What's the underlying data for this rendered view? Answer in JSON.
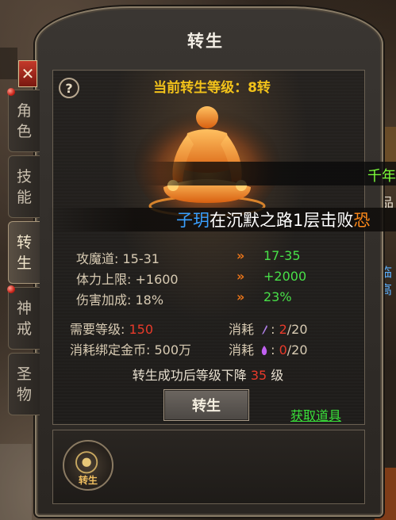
{
  "window": {
    "title": "转生",
    "close_label": "✕",
    "help_label": "?"
  },
  "tabs": [
    {
      "label": "角色",
      "chars": [
        "角",
        "色"
      ],
      "active": false
    },
    {
      "label": "技能",
      "chars": [
        "技",
        "能"
      ],
      "active": false
    },
    {
      "label": "转生",
      "chars": [
        "转",
        "生"
      ],
      "active": true
    },
    {
      "label": "神戒",
      "chars": [
        "神",
        "戒"
      ],
      "active": false
    },
    {
      "label": "圣物",
      "chars": [
        "圣",
        "物"
      ],
      "active": false
    }
  ],
  "panel": {
    "current_level_text": "当前转生等级：8转",
    "stats": [
      {
        "label": "攻魔道: 15-31",
        "next": "17-35"
      },
      {
        "label": "体力上限: +1600",
        "next": "+2000"
      },
      {
        "label": "伤害加成: 18%",
        "next": "23%"
      }
    ],
    "arrow_glyph": "»",
    "requirements": {
      "level_label": "需要等级:",
      "level_value": "150",
      "gold_label": "消耗绑定金币: 500万",
      "consume_label_1": "消耗",
      "consume_have_1": "2",
      "consume_need_1": "/20",
      "consume_label_2": "消耗",
      "consume_have_2": "0",
      "consume_need_2": "/20"
    },
    "level_drop_prefix": "转生成功后等级下降",
    "level_drop_value": "35",
    "level_drop_suffix": "级",
    "rebirth_button": "转生",
    "get_items_link": "获取道具",
    "badge_label": "转生"
  },
  "kill_feed": {
    "player_name": "子玥",
    "message": "在沉默之路1层击败",
    "tail": "恐",
    "top_partial": "千年"
  },
  "edge_texts": {
    "right_1": "品",
    "right_2": "临",
    "right_3": "高"
  },
  "colors": {
    "gold_title": "#f2c21a",
    "stat_next_green": "#48e048",
    "value_red": "#e83a2a",
    "link_green": "#3ae23a",
    "player_blue": "#3aa0ff",
    "arrow_orange": "#e8741a"
  }
}
